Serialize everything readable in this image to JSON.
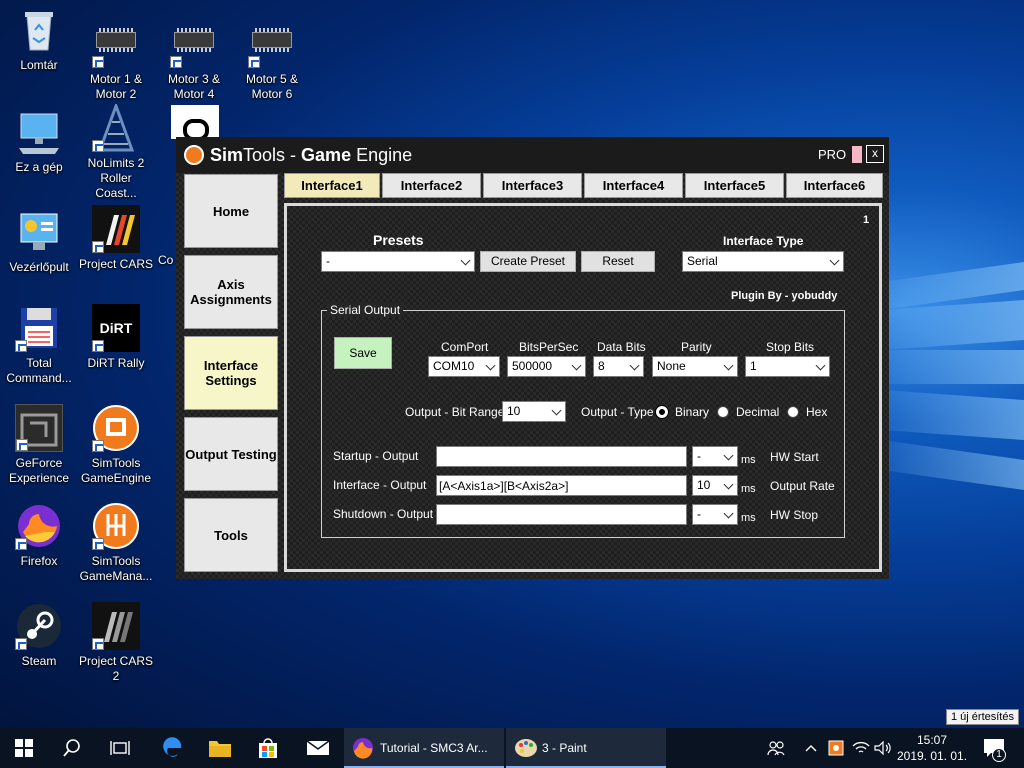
{
  "desktop": {
    "icons": [
      {
        "label": "Lomtár"
      },
      {
        "label": "Motor 1 & Motor 2"
      },
      {
        "label": "Motor 3 & Motor 4"
      },
      {
        "label": "Motor 5 & Motor 6"
      },
      {
        "label": "Ez a gép"
      },
      {
        "label": "NoLimits 2 Roller Coast..."
      },
      {
        "label": "Vezérlőpult"
      },
      {
        "label": "Project CARS"
      },
      {
        "label": "Co"
      },
      {
        "label": "Total Command..."
      },
      {
        "label": "DiRT Rally"
      },
      {
        "label": "GeForce Experience"
      },
      {
        "label": "SimTools GameEngine"
      },
      {
        "label": "Firefox"
      },
      {
        "label": "SimTools GameMana..."
      },
      {
        "label": "Steam"
      },
      {
        "label": "Project CARS 2"
      }
    ]
  },
  "window": {
    "title_sim": "Sim",
    "title_tools": "Tools",
    "title_dash": " - ",
    "title_game": "Game",
    "title_engine": " Engine",
    "pro_label": "PRO",
    "close_label": "x",
    "sidebar": [
      {
        "label": "Home"
      },
      {
        "label": "Axis Assignments"
      },
      {
        "label": "Interface Settings"
      },
      {
        "label": "Output Testing"
      },
      {
        "label": "Tools"
      }
    ],
    "tabs": [
      {
        "label": "Interface1"
      },
      {
        "label": "Interface2"
      },
      {
        "label": "Interface3"
      },
      {
        "label": "Interface4"
      },
      {
        "label": "Interface5"
      },
      {
        "label": "Interface6"
      }
    ],
    "panel": {
      "number": "1",
      "presets_label": "Presets",
      "presets_value": "-",
      "create_preset": "Create Preset",
      "reset": "Reset",
      "interface_type_label": "Interface Type",
      "interface_type_value": "Serial",
      "plugin_by": "Plugin By - yobuddy",
      "serial_output_label": "Serial Output",
      "save": "Save",
      "comport_label": "ComPort",
      "comport_value": "COM10",
      "bits_per_sec_label": "BitsPerSec",
      "bits_per_sec_value": "500000",
      "data_bits_label": "Data Bits",
      "data_bits_value": "8",
      "parity_label": "Parity",
      "parity_value": "None",
      "stop_bits_label": "Stop Bits",
      "stop_bits_value": "1",
      "bit_range_label": "Output - Bit Range",
      "bit_range_value": "10",
      "output_type_label": "Output - Type",
      "type_binary": "Binary",
      "type_decimal": "Decimal",
      "type_hex": "Hex",
      "startup_label": "Startup - Output",
      "startup_value": "",
      "startup_ms_value": "-",
      "interface_label": "Interface - Output",
      "interface_value": "[A<Axis1a>][B<Axis2a>]",
      "interface_ms_value": "10",
      "shutdown_label": "Shutdown - Output",
      "shutdown_value": "",
      "shutdown_ms_value": "-",
      "ms": "ms",
      "hw_start": "HW Start",
      "output_rate": "Output Rate",
      "hw_stop": "HW Stop"
    }
  },
  "taskbar": {
    "app1": "Tutorial - SMC3 Ar...",
    "app2": "3 - Paint",
    "time": "15:07",
    "date": "2019. 01. 01.",
    "notif_count": "1",
    "toast": "1 új értesítés"
  },
  "colors": {
    "save_button": "#c5f2bf",
    "active_sidebar": "#f7f6c9",
    "active_tab": "#f2eab8",
    "accent_orange": "#f07a1c",
    "taskbar": "#0a1321"
  }
}
